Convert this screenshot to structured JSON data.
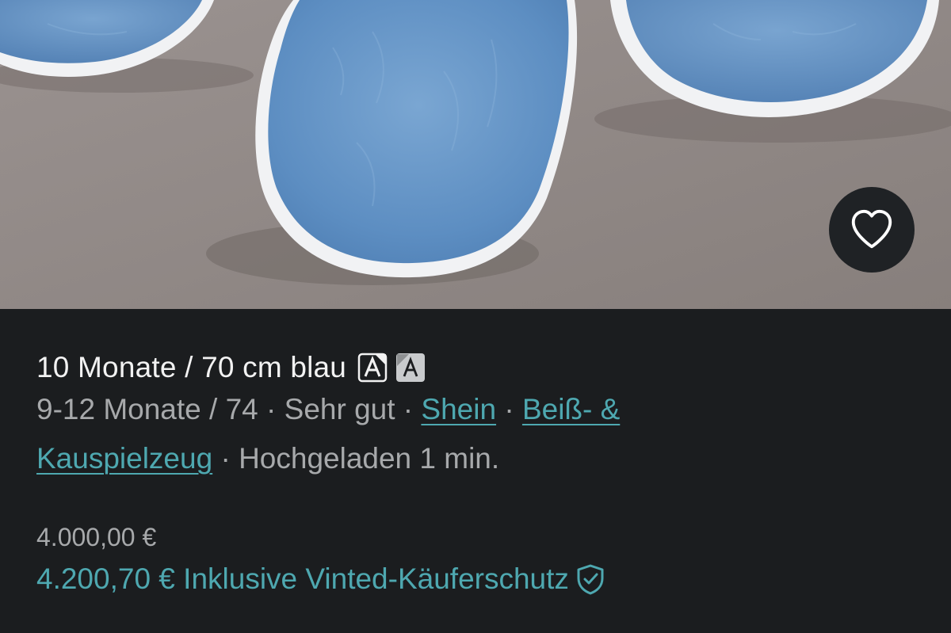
{
  "listing": {
    "title": "10 Monate / 70 cm blau",
    "size": "9-12 Monate / 74",
    "separator": "·",
    "condition": "Sehr gut",
    "brand": "Shein",
    "category_part1": "Beiß- &",
    "category_part2": "Kauspielzeug",
    "uploaded": "Hochgeladen 1 min.",
    "price": "4.000,00 €",
    "total_price": "4.200,70 € Inklusive Vinted-Käuferschutz"
  },
  "icons": {
    "favorite": "heart-icon",
    "translate_original": "translate-icon",
    "translate_active": "translate-icon",
    "protection": "shield-check-icon"
  },
  "colors": {
    "background": "#1b1d1f",
    "text_primary": "#f2f2f2",
    "text_secondary": "#a7a9ab",
    "accent": "#4ea8b0"
  }
}
